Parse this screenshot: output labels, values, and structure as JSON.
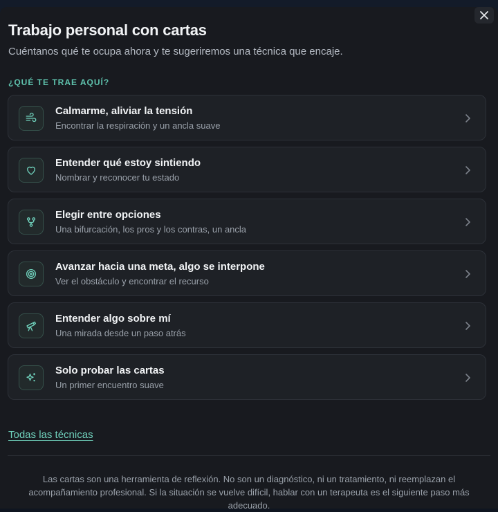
{
  "modal": {
    "title": "Trabajo personal con cartas",
    "subtitle": "Cuéntanos qué te ocupa ahora y te sugeriremos una técnica que encaje.",
    "section_label": "¿QUÉ TE TRAE AQUÍ?",
    "close_icon": "close-icon"
  },
  "options": [
    {
      "title": "Calmarme, aliviar la tensión",
      "desc": "Encontrar la respiración y un ancla suave",
      "icon": "wind-icon"
    },
    {
      "title": "Entender qué estoy sintiendo",
      "desc": "Nombrar y reconocer tu estado",
      "icon": "heart-icon"
    },
    {
      "title": "Elegir entre opciones",
      "desc": "Una bifurcación, los pros y los contras, un ancla",
      "icon": "fork-icon"
    },
    {
      "title": "Avanzar hacia una meta, algo se interpone",
      "desc": "Ver el obstáculo y encontrar el recurso",
      "icon": "target-icon"
    },
    {
      "title": "Entender algo sobre mí",
      "desc": "Una mirada desde un paso atrás",
      "icon": "telescope-icon"
    },
    {
      "title": "Solo probar las cartas",
      "desc": "Un primer encuentro suave",
      "icon": "sparkles-icon"
    }
  ],
  "all_techniques_link": "Todas las técnicas",
  "disclaimer": "Las cartas son una herramienta de reflexión. No son un diagnóstico, ni un tratamiento, ni reemplazan el acompañamiento profesional. Si la situación se vuelve difícil, hablar con un terapeuta es el siguiente paso más adecuado.",
  "colors": {
    "accent": "#5fc3ae",
    "background": "#181a1f",
    "card": "#1e2126"
  }
}
